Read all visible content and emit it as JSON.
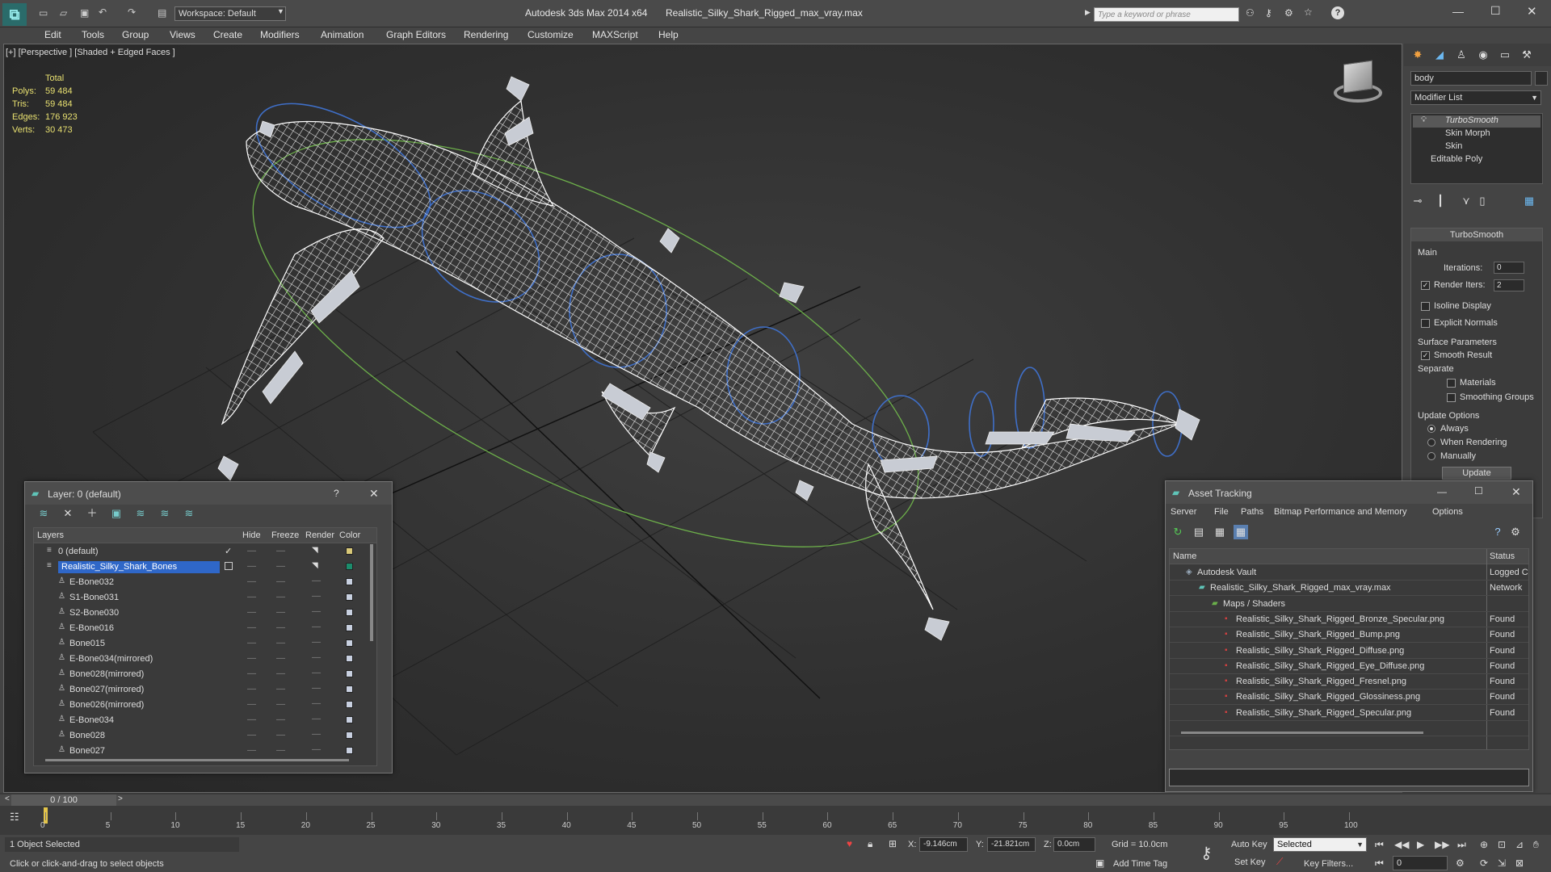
{
  "title": {
    "app": "Autodesk 3ds Max  2014 x64",
    "file": "Realistic_Silky_Shark_Rigged_max_vray.max",
    "workspace": "Workspace: Default",
    "search_placeholder": "Type a keyword or phrase"
  },
  "menu": [
    "Edit",
    "Tools",
    "Group",
    "Views",
    "Create",
    "Modifiers",
    "Animation",
    "Graph Editors",
    "Rendering",
    "Customize",
    "MAXScript",
    "Help"
  ],
  "viewport": {
    "label": "[+] [Perspective ] [Shaded + Edged Faces ]",
    "stats": {
      "header": "Total",
      "rows": [
        {
          "label": "Polys:",
          "value": "59 484"
        },
        {
          "label": "Tris:",
          "value": "59 484"
        },
        {
          "label": "Edges:",
          "value": "176 923"
        },
        {
          "label": "Verts:",
          "value": "30 473"
        }
      ]
    }
  },
  "command_panel": {
    "object_name": "body",
    "modifier_list": "Modifier List",
    "stack": [
      "TurboSmooth",
      "Skin Morph",
      "Skin",
      "Editable Poly"
    ],
    "rollout_title": "TurboSmooth",
    "main_label": "Main",
    "iterations_label": "Iterations:",
    "iterations_value": "0",
    "render_iters_label": "Render Iters:",
    "render_iters_value": "2",
    "isoline": "Isoline Display",
    "explicit_normals": "Explicit Normals",
    "surface_params": "Surface Parameters",
    "smooth_result": "Smooth Result",
    "separate": "Separate",
    "materials": "Materials",
    "smoothing_groups": "Smoothing Groups",
    "update_options": "Update Options",
    "always": "Always",
    "when_rendering": "When Rendering",
    "manually": "Manually",
    "update_button": "Update"
  },
  "layer_window": {
    "title": "Layer: 0 (default)",
    "help": "?",
    "columns": [
      "Layers",
      "Hide",
      "Freeze",
      "Render",
      "Color"
    ],
    "rows": [
      {
        "name": "0 (default)",
        "color": "#d8c878",
        "level": 0,
        "checked": true
      },
      {
        "name": "Realistic_Silky_Shark_Bones",
        "color": "#1c8c6c",
        "level": 0,
        "selected": true
      },
      {
        "name": "E-Bone032",
        "color": "#c8d0e0",
        "level": 1
      },
      {
        "name": "S1-Bone031",
        "color": "#c8d0e0",
        "level": 1
      },
      {
        "name": "S2-Bone030",
        "color": "#c8d0e0",
        "level": 1
      },
      {
        "name": "E-Bone016",
        "color": "#c8d0e0",
        "level": 1
      },
      {
        "name": "Bone015",
        "color": "#c8d0e0",
        "level": 1
      },
      {
        "name": "E-Bone034(mirrored)",
        "color": "#c8d0e0",
        "level": 1
      },
      {
        "name": "Bone028(mirrored)",
        "color": "#c8d0e0",
        "level": 1
      },
      {
        "name": "Bone027(mirrored)",
        "color": "#c8d0e0",
        "level": 1
      },
      {
        "name": "Bone026(mirrored)",
        "color": "#c8d0e0",
        "level": 1
      },
      {
        "name": "E-Bone034",
        "color": "#c8d0e0",
        "level": 1
      },
      {
        "name": "Bone028",
        "color": "#c8d0e0",
        "level": 1
      },
      {
        "name": "Bone027",
        "color": "#c8d0e0",
        "level": 1
      }
    ]
  },
  "asset_window": {
    "title": "Asset Tracking",
    "menu": [
      "Server",
      "File",
      "Paths",
      "Bitmap Performance and Memory",
      "Options"
    ],
    "columns": [
      "Name",
      "Status"
    ],
    "rows": [
      {
        "name": "Autodesk Vault",
        "status": "Logged C",
        "level": 0,
        "icon": "vault"
      },
      {
        "name": "Realistic_Silky_Shark_Rigged_max_vray.max",
        "status": "Network",
        "level": 1,
        "icon": "max"
      },
      {
        "name": "Maps / Shaders",
        "status": "",
        "level": 2,
        "icon": "folder"
      },
      {
        "name": "Realistic_Silky_Shark_Rigged_Bronze_Specular.png",
        "status": "Found",
        "level": 3,
        "icon": "png"
      },
      {
        "name": "Realistic_Silky_Shark_Rigged_Bump.png",
        "status": "Found",
        "level": 3,
        "icon": "png"
      },
      {
        "name": "Realistic_Silky_Shark_Rigged_Diffuse.png",
        "status": "Found",
        "level": 3,
        "icon": "png"
      },
      {
        "name": "Realistic_Silky_Shark_Rigged_Eye_Diffuse.png",
        "status": "Found",
        "level": 3,
        "icon": "png"
      },
      {
        "name": "Realistic_Silky_Shark_Rigged_Fresnel.png",
        "status": "Found",
        "level": 3,
        "icon": "png"
      },
      {
        "name": "Realistic_Silky_Shark_Rigged_Glossiness.png",
        "status": "Found",
        "level": 3,
        "icon": "png"
      },
      {
        "name": "Realistic_Silky_Shark_Rigged_Specular.png",
        "status": "Found",
        "level": 3,
        "icon": "png"
      }
    ]
  },
  "timeline": {
    "frame": "0 / 100",
    "ticks": [
      "0",
      "5",
      "10",
      "15",
      "20",
      "25",
      "30",
      "35",
      "40",
      "45",
      "50",
      "55",
      "60",
      "65",
      "70",
      "75",
      "80",
      "85",
      "90",
      "95",
      "100"
    ]
  },
  "status": {
    "selection": "1 Object Selected",
    "prompt": "Click or click-and-drag to select objects",
    "x_label": "X:",
    "x": "-9.146cm",
    "y_label": "Y:",
    "y": "-21.821cm",
    "z_label": "Z:",
    "z": "0.0cm",
    "grid": "Grid = 10.0cm",
    "add_time_tag": "Add Time Tag",
    "auto_key": "Auto Key",
    "set_key": "Set Key",
    "selected": "Selected",
    "key_filters": "Key Filters...",
    "frame_field": "0"
  }
}
